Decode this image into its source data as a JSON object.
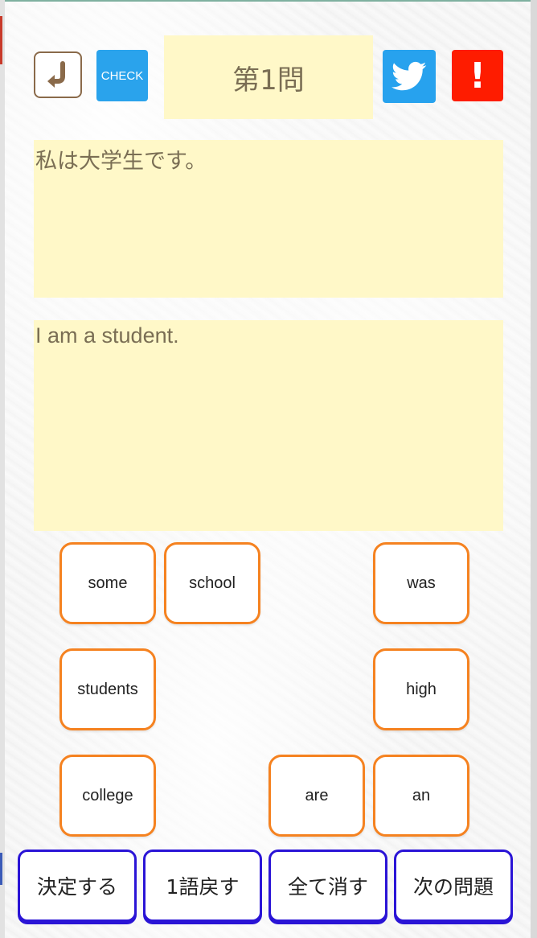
{
  "header": {
    "back_icon": "return-arrow-icon",
    "check_label": "CHECK",
    "question_label": "第1問",
    "twitter_icon": "twitter-bird-icon",
    "report_label": "!"
  },
  "prompt": {
    "japanese": "私は大学生です。",
    "english": "I am a student."
  },
  "tiles": [
    "some",
    "school",
    "was",
    "students",
    "high",
    "college",
    "are",
    "an"
  ],
  "actions": {
    "decide": "決定する",
    "undo_one": "1語戻す",
    "clear_all": "全て消す",
    "next": "次の問題"
  },
  "colors": {
    "tile_border": "#f58220",
    "action_border": "#2a14d6",
    "panel_bg": "#fff8c8",
    "check_bg": "#2aa3ec",
    "twitter_bg": "#27a2ee",
    "report_bg": "#fe1c00"
  }
}
